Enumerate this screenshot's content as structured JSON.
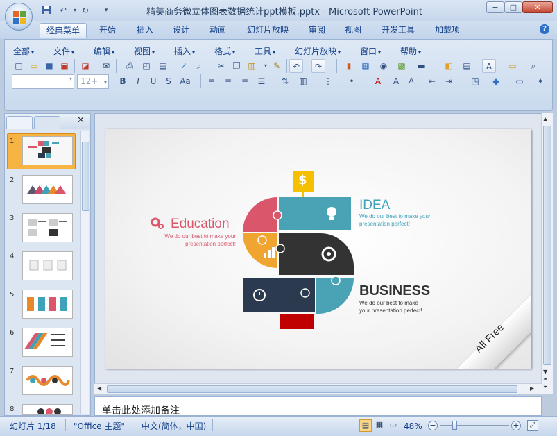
{
  "window": {
    "title": "精美商务微立体图表数据统计ppt模板.pptx - Microsoft PowerPoint",
    "min": "−",
    "max": "□",
    "close": "✕"
  },
  "quick_access": [
    "save-icon",
    "undo-icon",
    "redo-icon",
    "customize-icon"
  ],
  "tabs": [
    "经典菜单",
    "开始",
    "插入",
    "设计",
    "动画",
    "幻灯片放映",
    "审阅",
    "视图",
    "开发工具",
    "加载项"
  ],
  "menus": [
    "全部",
    "文件",
    "编辑",
    "视图",
    "插入",
    "格式",
    "工具",
    "幻灯片放映",
    "窗口",
    "帮助"
  ],
  "font_size_placeholder": "12+",
  "help": "?",
  "pane_close": "✕",
  "slides": [
    "1",
    "2",
    "3",
    "4",
    "5",
    "6",
    "7",
    "8"
  ],
  "slide": {
    "education": {
      "title": "Education",
      "line1": "We do our best to make your",
      "line2": "presentation perfect!"
    },
    "idea": {
      "title": "IDEA",
      "line1": "We do our best to make your",
      "line2": "presentation perfect!"
    },
    "business": {
      "title": "BUSINESS",
      "line1": "We do our best to make",
      "line2": "your presentation perfect!"
    },
    "corner": "All Free",
    "dollar": "$"
  },
  "notes_placeholder": "单击此处添加备注",
  "status": {
    "slide_count": "幻灯片 1/18",
    "theme": "\"Office 主题\"",
    "language": "中文(简体，中国)",
    "zoom": "48%",
    "zoom_level": 0.48
  },
  "colors": {
    "accent_teal": "#4aa3b5",
    "accent_pink": "#d9566b",
    "accent_orange": "#f1a531",
    "dark": "#333333",
    "navy": "#2c3a4f",
    "red": "#c00000",
    "gold": "#f5c000"
  }
}
